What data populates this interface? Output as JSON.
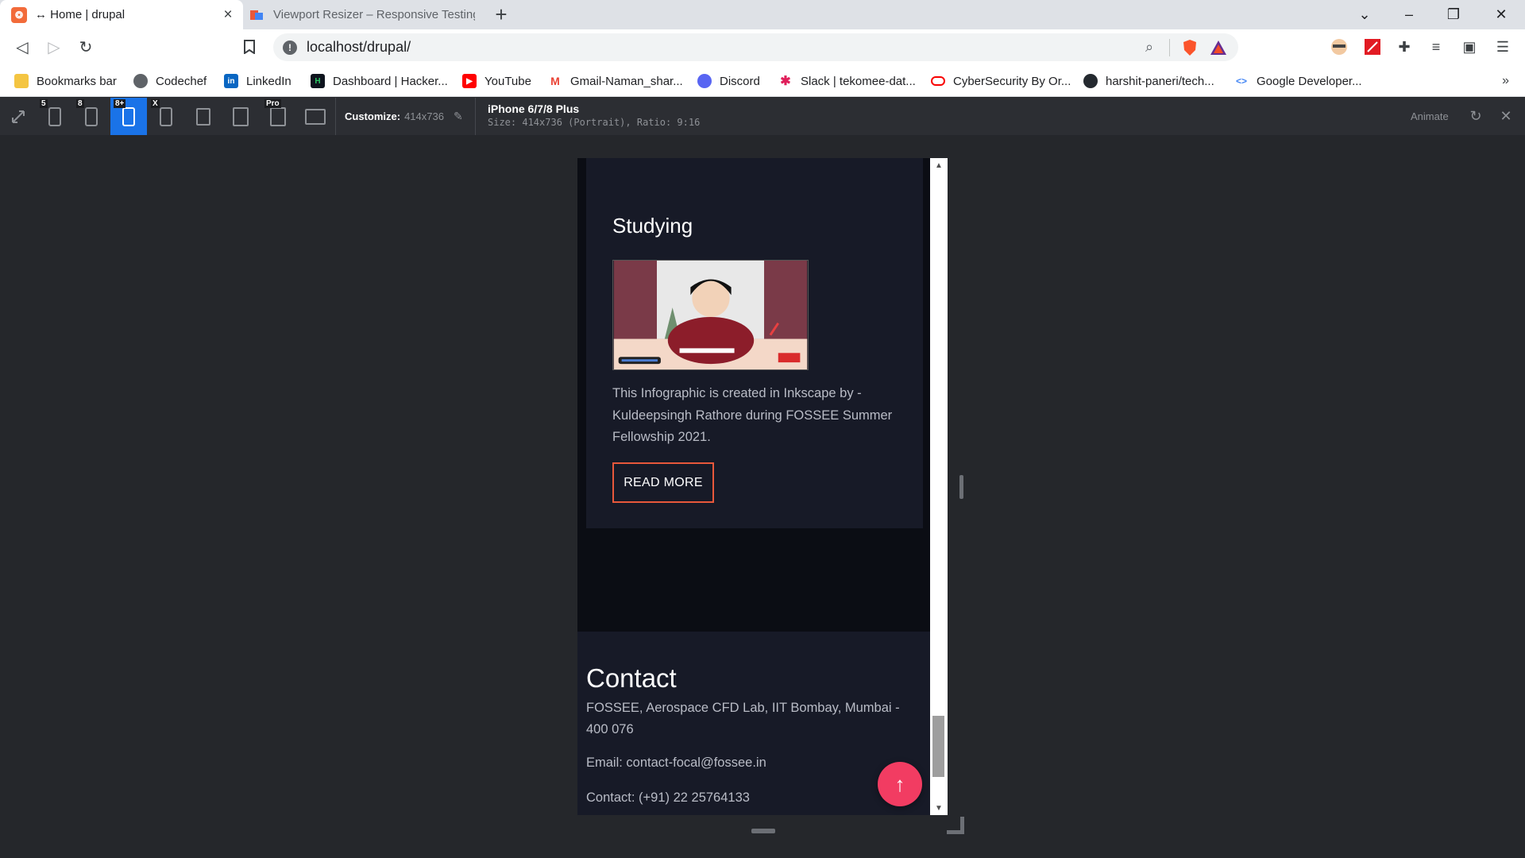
{
  "browser": {
    "tabs": [
      {
        "title": "↔ Home | drupal",
        "active": true
      },
      {
        "title": "Viewport Resizer – Responsive Testing",
        "active": false
      }
    ],
    "url": "localhost/drupal/"
  },
  "bookmarks": [
    {
      "label": "Bookmarks bar",
      "icon": "folder-icon"
    },
    {
      "label": "Codechef",
      "icon": "globe-icon"
    },
    {
      "label": "LinkedIn",
      "icon": "linkedin-icon"
    },
    {
      "label": "Dashboard | Hacker...",
      "icon": "hackerrank-icon"
    },
    {
      "label": "YouTube",
      "icon": "youtube-icon"
    },
    {
      "label": "Gmail-Naman_shar...",
      "icon": "gmail-icon"
    },
    {
      "label": "Discord",
      "icon": "discord-icon"
    },
    {
      "label": "Slack | tekomee-dat...",
      "icon": "slack-icon"
    },
    {
      "label": "CyberSecurity By Or...",
      "icon": "oracle-icon"
    },
    {
      "label": "harshit-paneri/tech...",
      "icon": "github-icon"
    },
    {
      "label": "Google Developer...",
      "icon": "google-dev-icon"
    }
  ],
  "resizer": {
    "device_badges": [
      "5",
      "8",
      "8+",
      "X",
      "",
      "",
      "Pro",
      ""
    ],
    "customize_label": "Customize:",
    "customize_value": "414x736",
    "device_name": "iPhone 6/7/8 Plus",
    "device_size": "Size: 414x736 (Portrait), Ratio: 9:16",
    "animate_label": "Animate"
  },
  "page": {
    "card": {
      "title": "Studying",
      "description": "This Infographic is created in Inkscape by - Kuldeepsingh Rathore during FOSSEE Summer Fellowship 2021.",
      "button": "READ MORE"
    },
    "contact": {
      "title": "Contact",
      "address": "FOSSEE, Aerospace CFD Lab, IIT Bombay, Mumbai - 400 076",
      "email": "Email: contact-focal@fossee.in",
      "phone": "Contact: (+91) 22 25764133"
    },
    "scroll_top": "↑"
  },
  "colors": {
    "accent_button_border": "#e8583b",
    "scroll_top_bg": "#f23c62",
    "resizer_active": "#1a73e8"
  }
}
